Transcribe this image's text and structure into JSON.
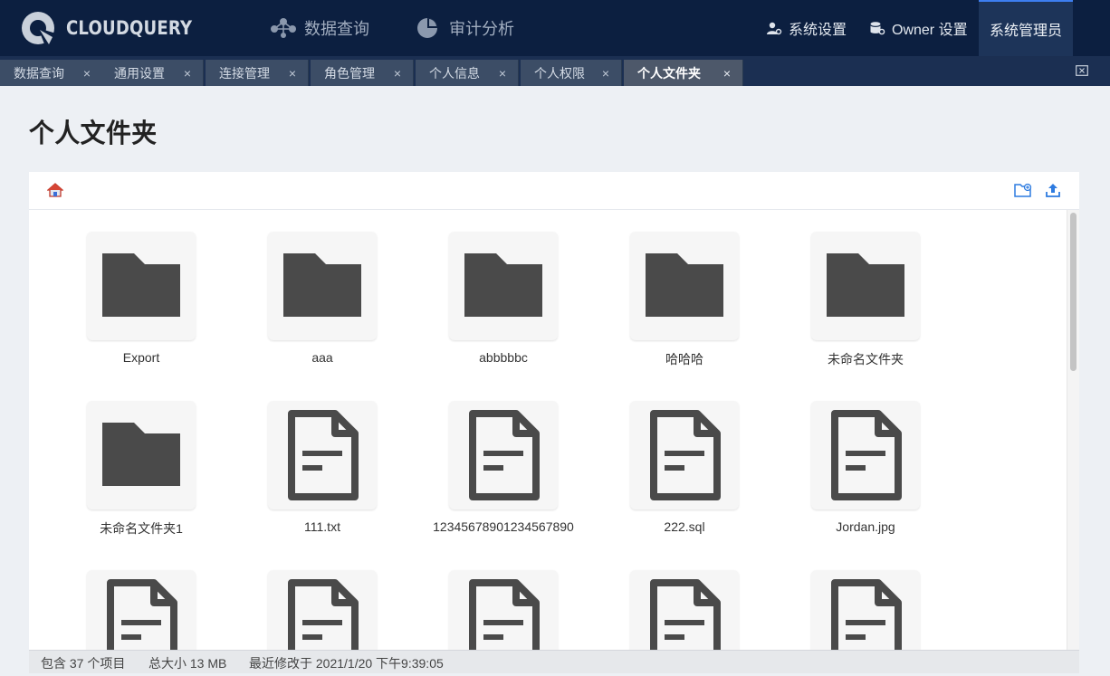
{
  "header": {
    "logo_text": "CLOUDQUERY",
    "nav": [
      {
        "label": "数据查询",
        "icon": "network-icon"
      },
      {
        "label": "审计分析",
        "icon": "pie-chart-icon"
      }
    ],
    "right": [
      {
        "label": "系统设置",
        "icon": "user-settings-icon"
      },
      {
        "label": "Owner 设置",
        "icon": "database-settings-icon"
      }
    ],
    "admin_label": "系统管理员"
  },
  "tabs": [
    {
      "label": "数据查询",
      "active": false
    },
    {
      "label": "通用设置",
      "active": false
    },
    {
      "label": "连接管理",
      "active": false
    },
    {
      "label": "角色管理",
      "active": false
    },
    {
      "label": "个人信息",
      "active": false
    },
    {
      "label": "个人权限",
      "active": false
    },
    {
      "label": "个人文件夹",
      "active": true
    }
  ],
  "tab_close_glyph": "×",
  "page": {
    "title": "个人文件夹"
  },
  "toolbar": {
    "home_icon": "home-icon",
    "new_folder_icon": "new-folder-icon",
    "upload_icon": "upload-icon"
  },
  "files": [
    {
      "name": "Export",
      "type": "folder"
    },
    {
      "name": "aaa",
      "type": "folder"
    },
    {
      "name": "abbbbbc",
      "type": "folder"
    },
    {
      "name": "哈哈哈",
      "type": "folder"
    },
    {
      "name": "未命名文件夹",
      "type": "folder"
    },
    {
      "name": "未命名文件夹1",
      "type": "folder"
    },
    {
      "name": "111.txt",
      "type": "file"
    },
    {
      "name": "12345678901234567890",
      "type": "file"
    },
    {
      "name": "222.sql",
      "type": "file"
    },
    {
      "name": "Jordan.jpg",
      "type": "file"
    },
    {
      "name": "",
      "type": "file"
    },
    {
      "name": "",
      "type": "file"
    },
    {
      "name": "",
      "type": "file"
    },
    {
      "name": "",
      "type": "file"
    },
    {
      "name": "",
      "type": "file"
    }
  ],
  "status": {
    "count": "包含 37 个项目",
    "size": "总大小 13 MB",
    "modified": "最近修改于 2021/1/20 下午9:39:05"
  },
  "colors": {
    "header_bg": "#0c1f40",
    "tab_strip_bg": "#1b2f52",
    "accent": "#3d7ef0",
    "icon_dark": "#4a4a4a",
    "page_bg": "#edf0f4"
  }
}
